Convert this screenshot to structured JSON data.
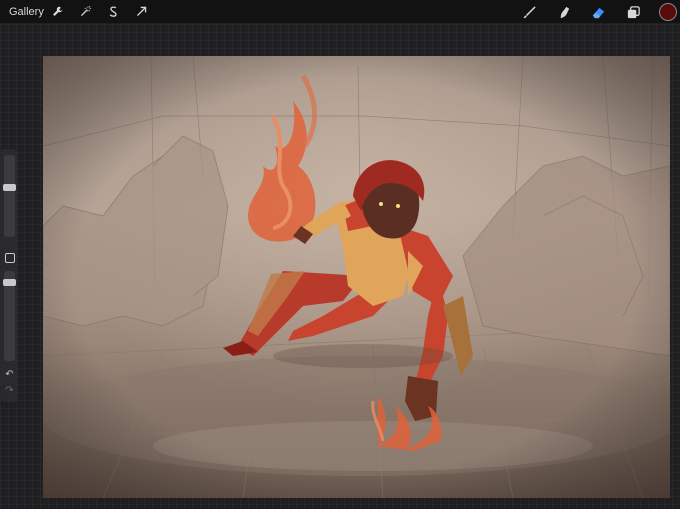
{
  "topbar": {
    "gallery_label": "Gallery",
    "left_tools": [
      "wrench-icon",
      "magic-wand-icon",
      "selection-s-icon",
      "transform-arrow-icon"
    ],
    "right_tools": [
      "brush-icon",
      "smudge-icon",
      "eraser-icon",
      "layers-icon"
    ],
    "active_tool": "eraser-icon",
    "current_color": "#5a0b0b",
    "accent_color": "#3b8ff5"
  },
  "sidebar": {
    "brush_size_level": 0.62,
    "opacity_level": 0.9,
    "undo_icon": "undo-icon",
    "redo_icon": "redo-icon",
    "modify_icon": "square-icon"
  },
  "canvas": {
    "artwork": "painting-character-fire"
  }
}
